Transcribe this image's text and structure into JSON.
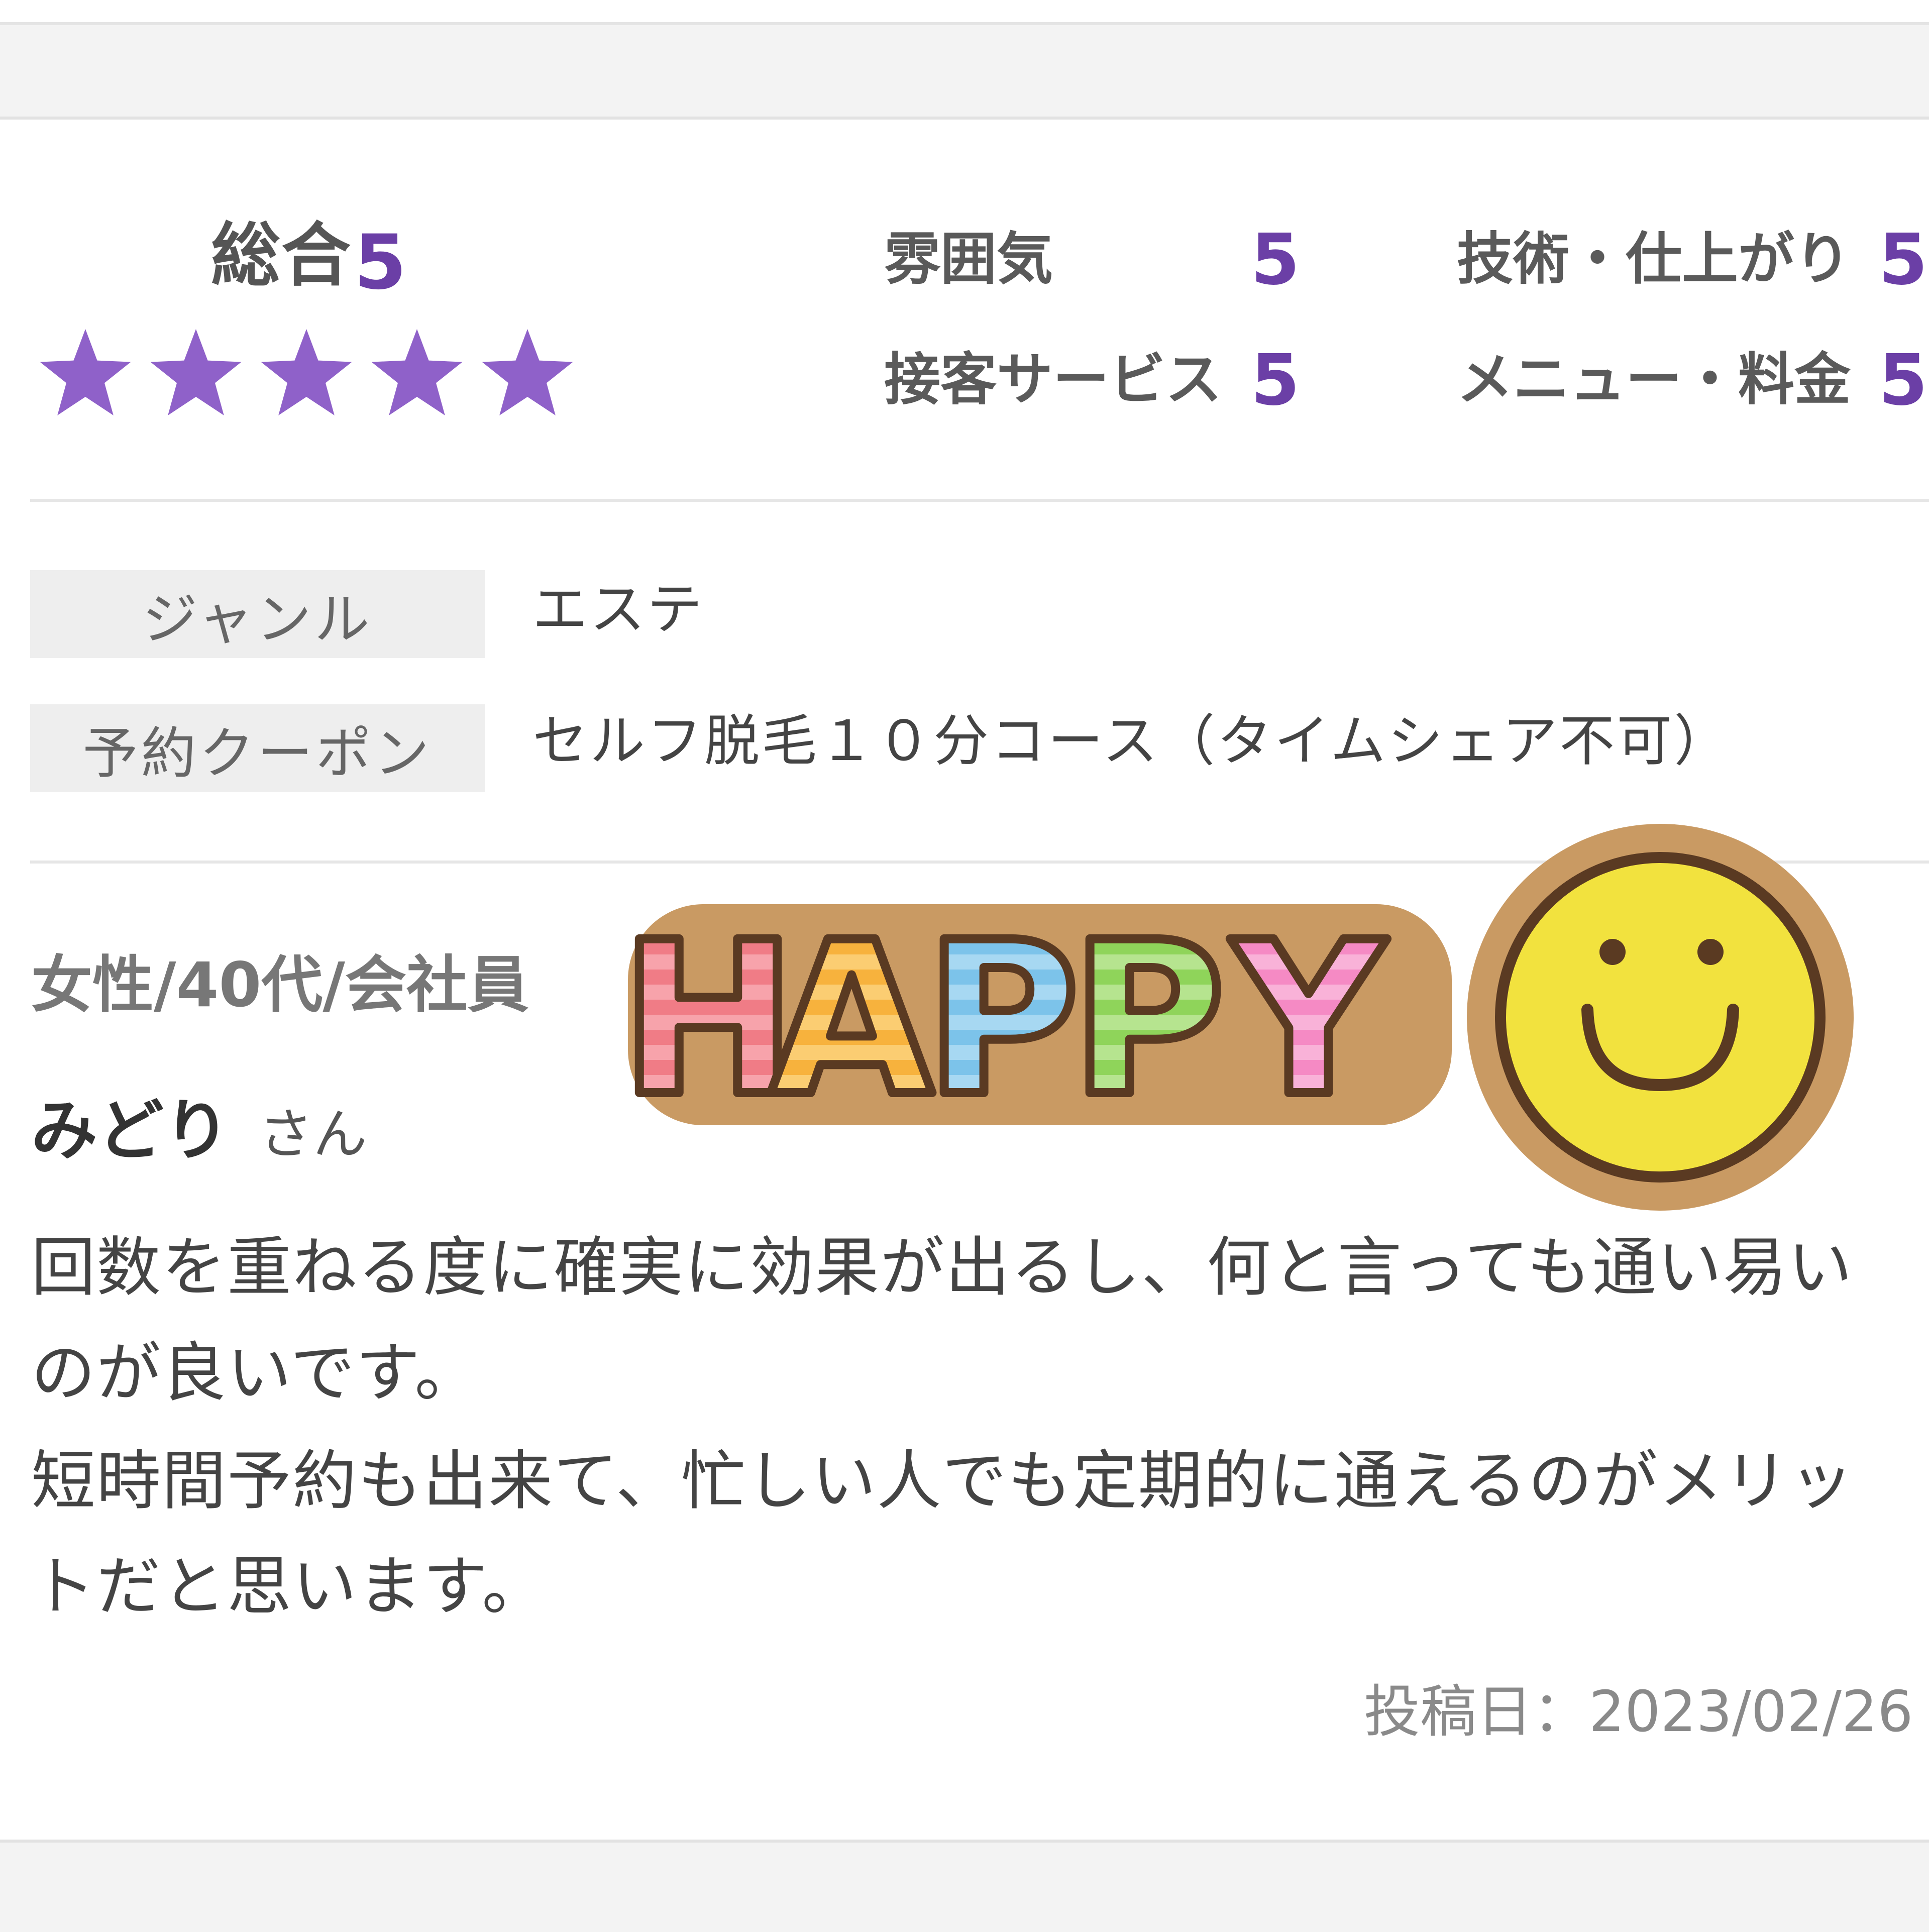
{
  "overall": {
    "label": "総合",
    "value": "5",
    "stars": 5,
    "star_color": "#8f61c9"
  },
  "categories": [
    {
      "label": "雰囲気",
      "value": "5"
    },
    {
      "label": "技術・仕上がり",
      "value": "5"
    },
    {
      "label": "接客サービス",
      "value": "5"
    },
    {
      "label": "メニュー・料金",
      "value": "5"
    }
  ],
  "info": [
    {
      "label": "ジャンル",
      "value": "エステ"
    },
    {
      "label": "予約クーポン",
      "value": "セルフ脱毛１０分コース（タイムシェア不可）"
    }
  ],
  "reviewer": {
    "profile": "女性/40代/会社員",
    "name": "みどり",
    "suffix": "さん"
  },
  "review": {
    "lines": [
      "回数を重ねる度に確実に効果が出るし、何と言っても通い易い",
      "のが良いです。",
      "短時間予約も出来て、忙しい人でも定期的に通えるのがメリッ",
      "トだと思います。"
    ],
    "date": "投稿日：2023/02/26"
  },
  "sticker": {
    "text": "HAPPY",
    "letter_colors": [
      "#f07c86",
      "#f7b23d",
      "#7cc3ea",
      "#8fd45a",
      "#f58ac4"
    ],
    "face_color": "#f2e23e",
    "wood_color": "#c99a63",
    "outline_color": "#5a3a22"
  },
  "accent_color": "#6b3fa6"
}
